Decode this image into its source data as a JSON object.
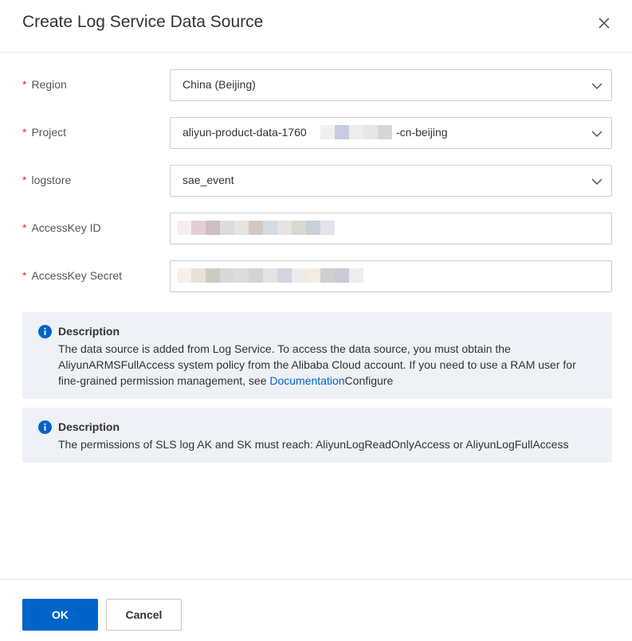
{
  "dialog": {
    "title": "Create Log Service Data Source"
  },
  "form": {
    "region": {
      "label": "Region",
      "value": "China (Beijing)"
    },
    "project": {
      "label": "Project",
      "value_prefix": "aliyun-product-data-1760",
      "value_suffix": "-cn-beijing"
    },
    "logstore": {
      "label": "logstore",
      "value": "sae_event"
    },
    "access_key_id": {
      "label": "AccessKey ID"
    },
    "access_key_secret": {
      "label": "AccessKey Secret"
    },
    "required_mark": "*"
  },
  "notices": [
    {
      "title": "Description",
      "body_before": "The data source is added from Log Service. To access the data source, you must obtain the AliyunARMSFullAccess system policy from the Alibaba Cloud account. If you need to use a RAM user for fine-grained permission management, see ",
      "link": "Documentation",
      "body_after": "Configure"
    },
    {
      "title": "Description",
      "body": "The permissions of SLS log AK and SK must reach: AliyunLogReadOnlyAccess or AliyunLogFullAccess"
    }
  ],
  "footer": {
    "ok_label": "OK",
    "cancel_label": "Cancel"
  },
  "colors": {
    "primary": "#0064c8",
    "required": "#d93026",
    "notice_bg": "#eef1f6"
  },
  "icons": {
    "close": "close-icon",
    "dropdown": "chevron-down-icon",
    "info": "info-icon"
  }
}
